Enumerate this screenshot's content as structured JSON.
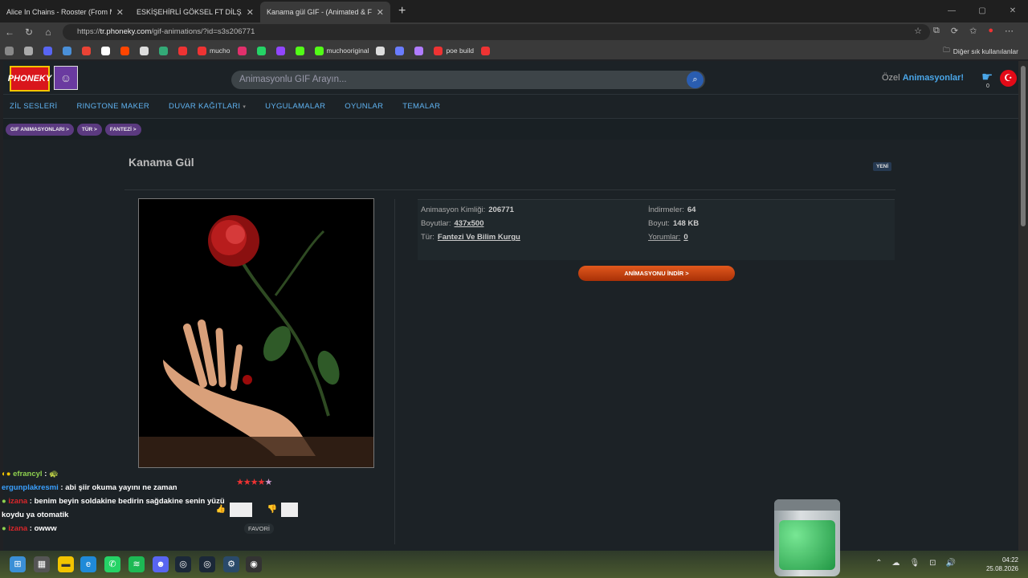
{
  "browser": {
    "tabs": [
      {
        "title": "Alice In Chains - Rooster (From MTV",
        "color": "#e33"
      },
      {
        "title": "ESKİŞEHİRLİ GÖKSEL FT DİLŞAH Gi",
        "color": "#e33"
      },
      {
        "title": "Kanama gül GIF - (Animated & Fre",
        "color": "#4aa6e8"
      }
    ],
    "url_prefix": "https://",
    "url_host": "tr.phoneky.com",
    "url_path": "/gif-animations/?id=s3s206771",
    "bookmarks": [
      {
        "label": "",
        "color": "#888"
      },
      {
        "label": "",
        "color": "#aaa"
      },
      {
        "label": "",
        "color": "#5865f2"
      },
      {
        "label": "",
        "color": "#4a8fd8"
      },
      {
        "label": "",
        "color": "#ea4335"
      },
      {
        "label": "",
        "color": "#fff"
      },
      {
        "label": "",
        "color": "#ff4500"
      },
      {
        "label": "",
        "color": "#ddd"
      },
      {
        "label": "",
        "color": "#3a7"
      },
      {
        "label": "",
        "color": "#e33"
      },
      {
        "label": "mucho",
        "color": "#e33"
      },
      {
        "label": "",
        "color": "#e1306c"
      },
      {
        "label": "",
        "color": "#25d366"
      },
      {
        "label": "",
        "color": "#9146ff"
      },
      {
        "label": "",
        "color": "#53fc18"
      },
      {
        "label": "muchooriginal",
        "color": "#53fc18"
      },
      {
        "label": "",
        "color": "#ddd"
      },
      {
        "label": "",
        "color": "#6a7cff"
      },
      {
        "label": "",
        "color": "#b07cff"
      },
      {
        "label": "poe build",
        "color": "#e33"
      },
      {
        "label": "",
        "color": "#e33"
      }
    ],
    "other_bookmarks": "Diğer sık kullanılanlar"
  },
  "site": {
    "logo_text": "PHONEKY",
    "search_placeholder": "Animasyonlu GIF Arayın...",
    "promo_prefix": "Özel",
    "promo_link": "Animasyonlar!",
    "cart_count": "0",
    "menu": [
      "ZİL SESLERİ",
      "RINGTONE MAKER",
      "DUVAR KAĞITLARI",
      "UYGULAMALAR",
      "OYUNLAR",
      "TEMALAR"
    ],
    "breadcrumbs": [
      "GIF ANIMASYONLARI >",
      "TÜR >",
      "FANTEZİ >"
    ],
    "title": "Kanama Gül",
    "badge": "YENİ",
    "info": {
      "id_label": "Animasyon Kimliği:",
      "id_value": "206771",
      "size_label": "Boyutlar:",
      "size_value": "437x500",
      "type_label": "Tür:",
      "type_value": "Fantezi Ve Bilim Kurgu",
      "downloads_label": "İndirmeler:",
      "downloads_value": "64",
      "filesize_label": "Boyut:",
      "filesize_value": "148 KB",
      "comments_label": "Yorumlar:",
      "comments_value": "0"
    },
    "download_button": "ANİMASYONU İNDİR >",
    "rating_stars": 4.5,
    "favorite": "FAVORİ"
  },
  "chat": [
    {
      "user": "efrancyl",
      "msg": ""
    },
    {
      "user": "ergunplakresmi",
      "msg": "abi şiir okuma yayını ne zaman"
    },
    {
      "user": "izana",
      "msg": "benim beyin soldakine bedirin sağdakine senin yüzü koydu ya otomatik"
    },
    {
      "user": "izana",
      "msg": "owww"
    }
  ],
  "clock": {
    "time": "04:22",
    "date": "25.08.2026"
  }
}
